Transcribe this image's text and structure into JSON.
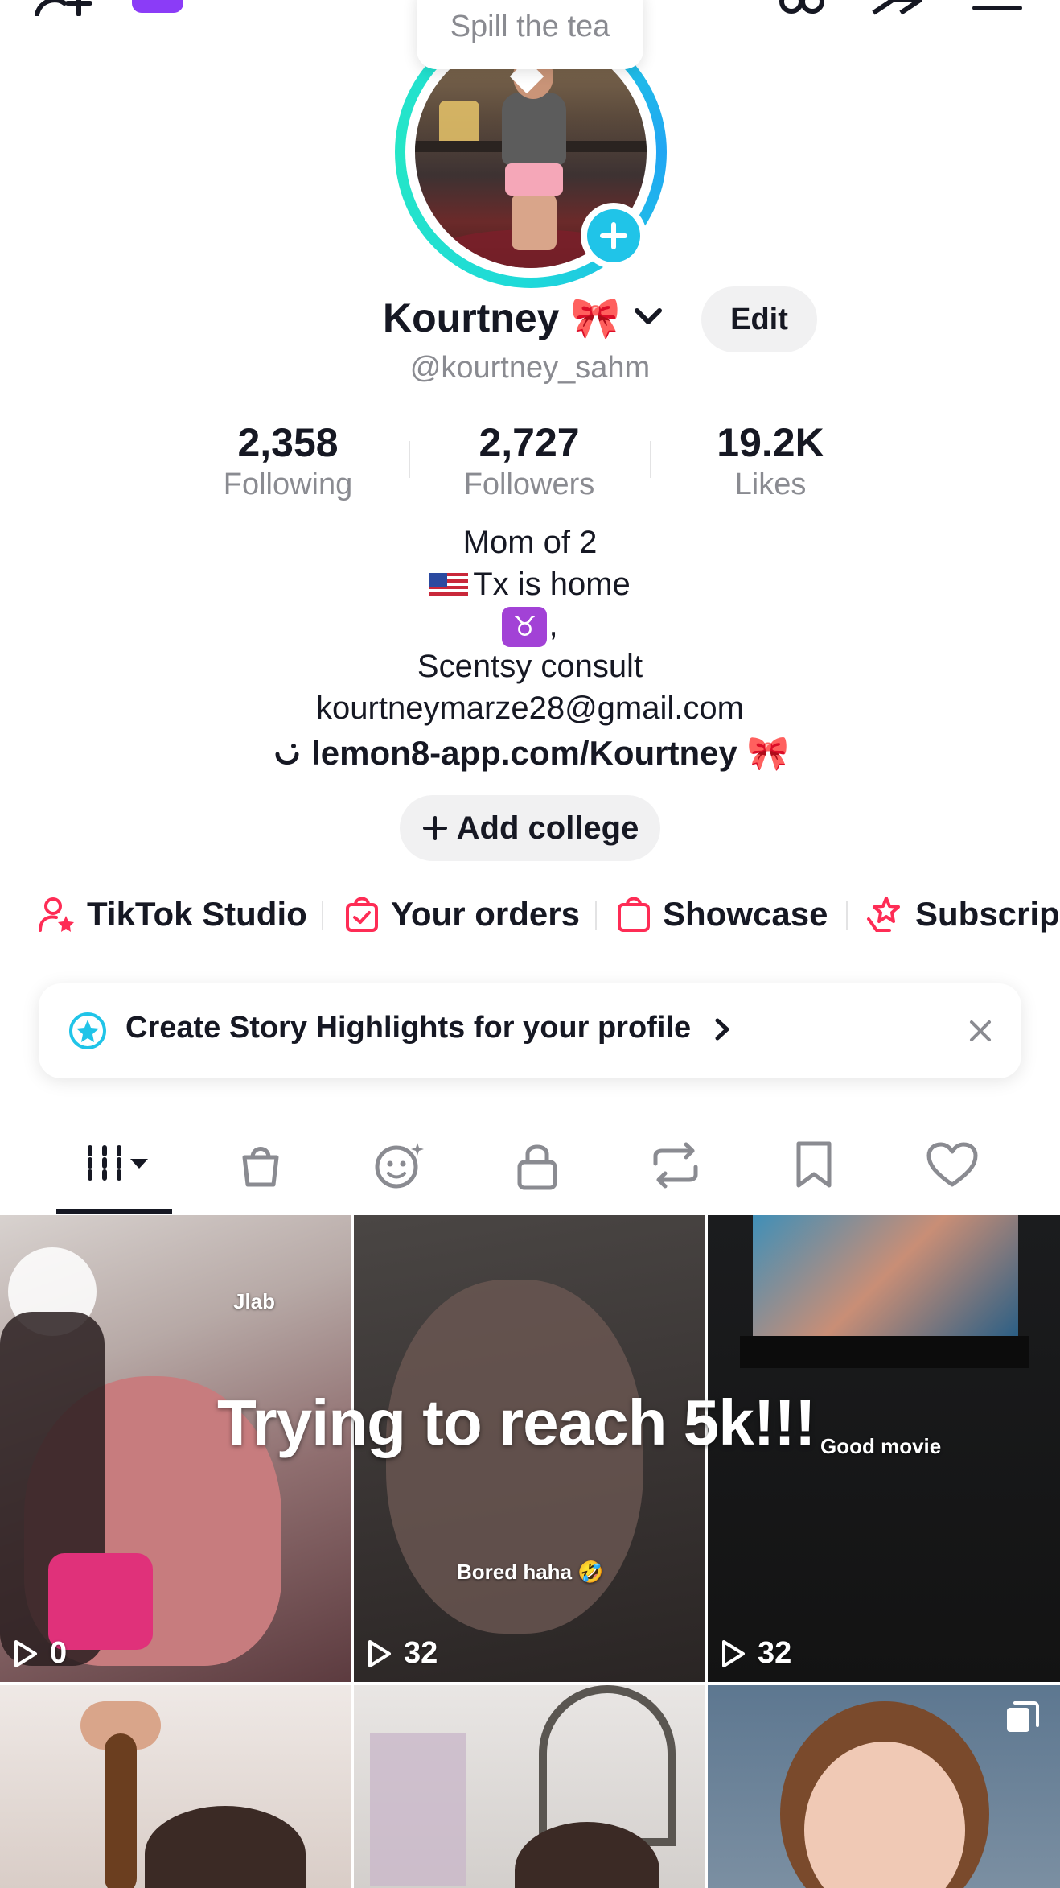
{
  "tooltip": {
    "text": "Spill the tea"
  },
  "profile": {
    "name": "Kourtney",
    "name_emoji": "🎀",
    "username": "@kourtney_sahm",
    "edit_label": "Edit"
  },
  "stats": [
    {
      "value": "2,358",
      "label": "Following"
    },
    {
      "value": "2,727",
      "label": "Followers"
    },
    {
      "value": "19.2K",
      "label": "Likes"
    }
  ],
  "bio": {
    "line1": "Mom of 2",
    "line2": "Tx is home",
    "line3_symbol": "♉",
    "line3_suffix": ",",
    "line4": "Scentsy consult",
    "line5": "kourtneymarze28@gmail.com",
    "link": "lemon8-app.com/Kourtney",
    "link_emoji": "🎀"
  },
  "college_button": {
    "label": "Add college"
  },
  "shortcuts": [
    {
      "label": "TikTok Studio",
      "icon": "person-star-icon"
    },
    {
      "label": "Your orders",
      "icon": "bag-check-icon"
    },
    {
      "label": "Showcase",
      "icon": "shopping-bag-icon"
    },
    {
      "label": "Subscript",
      "icon": "star-hands-icon"
    }
  ],
  "banner": {
    "text": "Create Story Highlights for your profile"
  },
  "tabs": [
    "videos-tab",
    "shop-tab",
    "favorites-creators-tab",
    "private-tab",
    "reposts-tab",
    "saved-tab",
    "liked-tab"
  ],
  "overlay_text": "Trying to reach 5k!!!",
  "videos": [
    {
      "caption": "Jlab",
      "views": "0"
    },
    {
      "caption": "Bored haha 🤣",
      "views": "32"
    },
    {
      "caption": "Good movie",
      "views": "32"
    }
  ],
  "colors": {
    "accent": "#fe2c55",
    "ring": "#20c4e8",
    "text": "#161823",
    "muted": "#8a8b91"
  }
}
